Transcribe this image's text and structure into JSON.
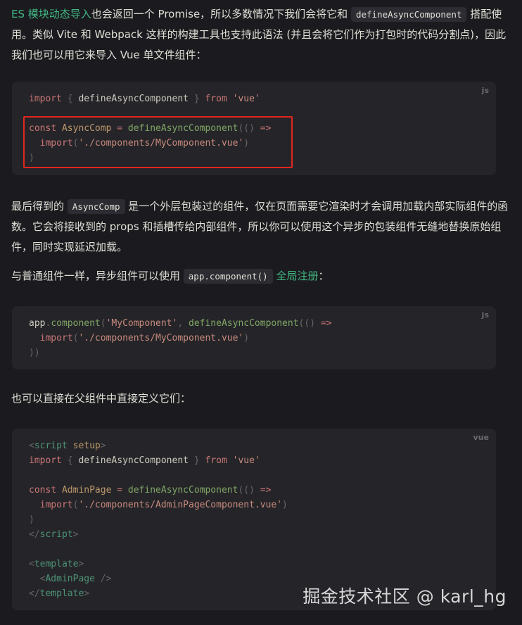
{
  "p1": {
    "link": "ES 模块动态导入",
    "t1": "也会返回一个 Promise，所以多数情况下我们会将它和 ",
    "code": "defineAsyncComponent",
    "t2": " 搭配使用。类似 Vite 和 Webpack 这样的构建工具也支持此语法 (并且会将它们作为打包时的代码分割点)，因此我们也可以用它来导入 Vue 单文件组件："
  },
  "code1": {
    "lang": "js",
    "l1": {
      "kw": "import",
      "a": " { ",
      "id": "defineAsyncComponent",
      "b": " } ",
      "from": "from",
      "sp": " ",
      "str": "'vue'"
    },
    "l3": {
      "kw": "const",
      "sp": " ",
      "name": "AsyncComp",
      "op": " = ",
      "fn": "defineAsyncComponent",
      "p": "(() ",
      "arrow": "=>"
    },
    "l4": {
      "indent": "  ",
      "kw": "import",
      "p1": "(",
      "str": "'./components/MyComponent.vue'",
      "p2": ")"
    },
    "l5": ")"
  },
  "p2": {
    "t1": "最后得到的 ",
    "code": "AsyncComp",
    "t2": " 是一个外层包装过的组件，仅在页面需要它渲染时才会调用加载内部实际组件的函数。它会将接收到的 props 和插槽传给内部组件，所以你可以使用这个异步的包装组件无缝地替换原始组件，同时实现延迟加载。"
  },
  "p3": {
    "t1": "与普通组件一样，异步组件可以使用 ",
    "code": "app.component()",
    "sp": " ",
    "link": "全局注册",
    "t2": "："
  },
  "code2": {
    "lang": "js",
    "l1": {
      "obj": "app",
      "dot": ".",
      "fn": "component",
      "p1": "(",
      "str": "'MyComponent'",
      "c": ", ",
      "fn2": "defineAsyncComponent",
      "p2": "(() ",
      "arrow": "=>"
    },
    "l2": {
      "indent": "  ",
      "kw": "import",
      "p1": "(",
      "str": "'./components/MyComponent.vue'",
      "p2": ")"
    },
    "l3": "))"
  },
  "p4": {
    "t1": "也可以直接在父组件中直接定义它们："
  },
  "code3": {
    "lang": "vue",
    "l1": {
      "lt": "<",
      "tag": "script",
      "sp": " ",
      "attr": "setup",
      "gt": ">"
    },
    "l2": {
      "kw": "import",
      "a": " { ",
      "id": "defineAsyncComponent",
      "b": " } ",
      "from": "from",
      "sp": " ",
      "str": "'vue'"
    },
    "l4": {
      "kw": "const",
      "sp": " ",
      "name": "AdminPage",
      "op": " = ",
      "fn": "defineAsyncComponent",
      "p": "(() ",
      "arrow": "=>"
    },
    "l5": {
      "indent": "  ",
      "kw": "import",
      "p1": "(",
      "str": "'./components/AdminPageComponent.vue'",
      "p2": ")"
    },
    "l6": ")",
    "l7": {
      "lt": "</",
      "tag": "script",
      "gt": ">"
    },
    "l9": {
      "lt": "<",
      "tag": "template",
      "gt": ">"
    },
    "l10": {
      "indent": "  ",
      "lt": "<",
      "tag": "AdminPage",
      "gt": " />"
    },
    "l11": {
      "lt": "</",
      "tag": "template",
      "gt": ">"
    }
  },
  "watermark": "掘金技术社区 @ karl_hg"
}
